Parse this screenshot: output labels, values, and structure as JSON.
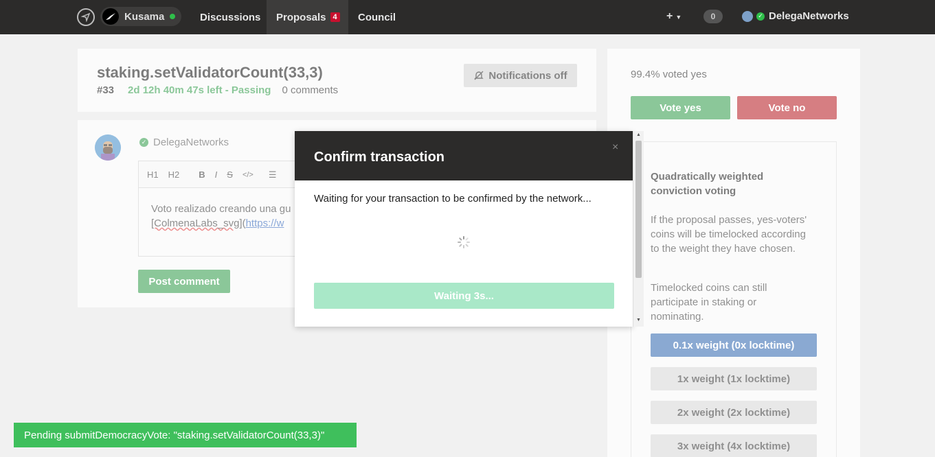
{
  "nav": {
    "chain_name": "Kusama",
    "links": [
      "Discussions",
      "Proposals",
      "Council"
    ],
    "proposals_badge": "4",
    "plus": "+",
    "notification_count": "0",
    "username": "DelegaNetworks"
  },
  "proposal": {
    "title": "staking.setValidatorCount(33,3)",
    "number": "#33",
    "time_left": "2d 12h 40m 47s left - Passing",
    "comments": "0 comments",
    "notifications_label": "Notifications off"
  },
  "comment": {
    "author": "DelegaNetworks",
    "toolbar": [
      "H1",
      "H2",
      "B",
      "I",
      "S",
      "</>"
    ],
    "body_line1": "Voto realizado creando una gu",
    "body_line2_a": "[ColmenaLabs_svg]",
    "body_line2_b": "(",
    "body_line2_link": "https://w",
    "post_label": "Post comment"
  },
  "voting": {
    "voted_text": "99.4% voted yes",
    "yes_label": "Vote yes",
    "no_label": "Vote no",
    "info_title": "Quadratically weighted conviction voting",
    "info_p1": "If the proposal passes, yes-voters' coins will be timelocked according to the weight they have chosen.",
    "info_p2": "Timelocked coins can still participate in staking or nominating.",
    "weights": [
      "0.1x weight (0x locktime)",
      "1x weight (1x locktime)",
      "2x weight (2x locktime)",
      "3x weight (4x locktime)"
    ]
  },
  "modal": {
    "title": "Confirm transaction",
    "close": "×",
    "message": "Waiting for your transaction to be confirmed by the network...",
    "button": "Waiting 3s..."
  },
  "toast": {
    "text": "Pending submitDemocracyVote: \"staking.setValidatorCount(33,3)\""
  },
  "colors": {
    "topbar": "#2c2b2a",
    "green": "#2c9a46",
    "red": "#b5141c",
    "blue": "#2a63ae",
    "toast": "#3fbf5c"
  }
}
